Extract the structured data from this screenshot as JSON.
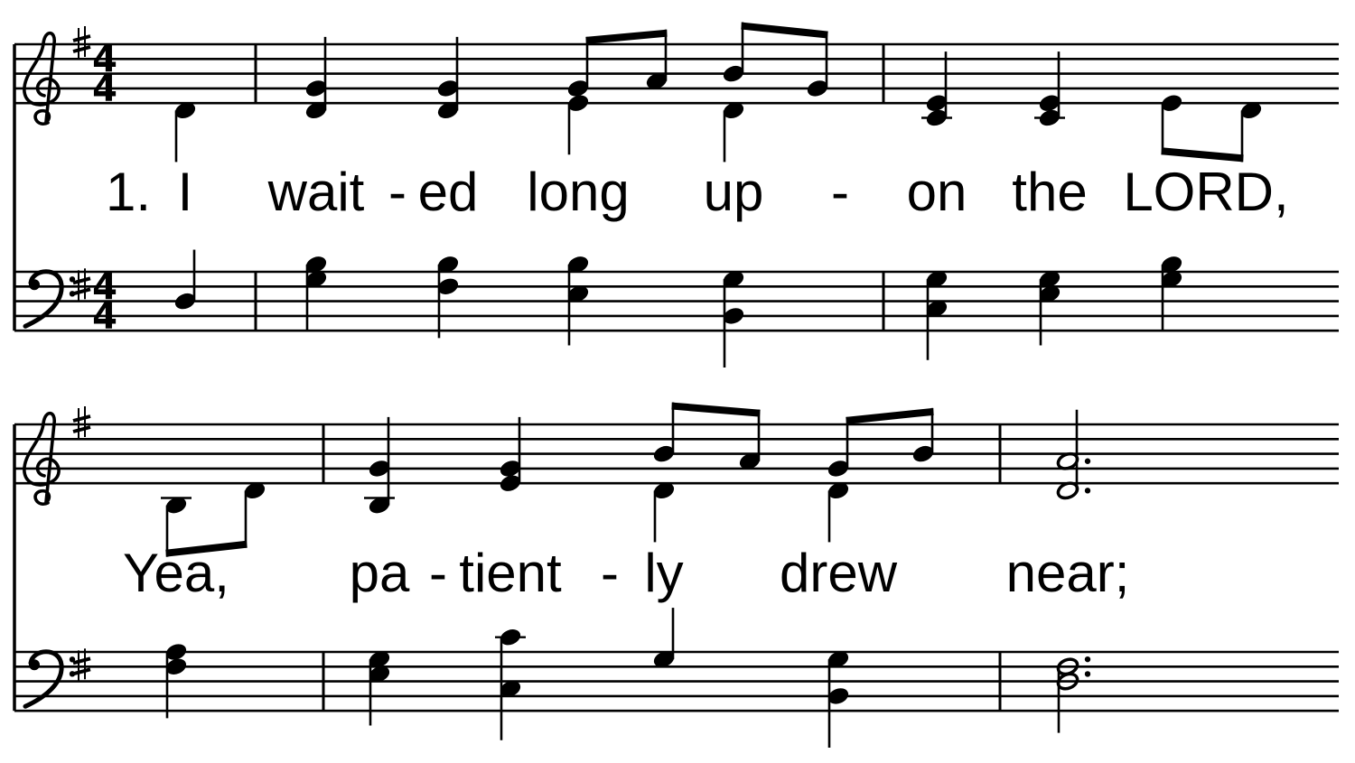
{
  "key_signature": "G major (1 sharp)",
  "time_signature": {
    "top": "4",
    "bottom": "4"
  },
  "ink_color": "#000000",
  "systems": [
    {
      "barlines": [
        "2-1",
        "3-1"
      ],
      "lyrics": [
        {
          "pos": "1-3.2",
          "text": "1."
        },
        {
          "pos": "1-4",
          "text": "I"
        },
        {
          "pos": "2-1",
          "text": "wait"
        },
        {
          "pos": "2-1.7",
          "text": "-"
        },
        {
          "pos": "2-2",
          "text": "ed"
        },
        {
          "pos": "2-3",
          "text": "long"
        },
        {
          "pos": "2-4",
          "text": "up"
        },
        {
          "pos": "2-4.6",
          "text": "-"
        },
        {
          "pos": "3-1",
          "text": "on"
        },
        {
          "pos": "3-2",
          "text": "the"
        },
        {
          "pos": "3-3.2",
          "text": "LORD,"
        }
      ],
      "treble": [
        {
          "pos": "1-4",
          "notes": [
            "D4"
          ],
          "dur": "q",
          "stem": "down"
        },
        {
          "pos": "2-1",
          "notes": [
            "G4",
            "D4"
          ],
          "dur": "q",
          "stem": "up"
        },
        {
          "pos": "2-2",
          "notes": [
            "G4",
            "D4"
          ],
          "dur": "q",
          "stem": "up"
        },
        {
          "pos": "2-3",
          "notes": [
            "G4"
          ],
          "dur": "e",
          "stem": "up",
          "beam": "a"
        },
        {
          "pos": "2-3.5",
          "notes": [
            "A4"
          ],
          "dur": "e",
          "stem": "up",
          "beam": "a"
        },
        {
          "pos": "2-3",
          "notes": [
            "E4"
          ],
          "dur": "q",
          "stem": "down"
        },
        {
          "pos": "2-4",
          "notes": [
            "B4"
          ],
          "dur": "e",
          "stem": "up",
          "beam": "b"
        },
        {
          "pos": "2-4.5",
          "notes": [
            "G4"
          ],
          "dur": "e",
          "stem": "up",
          "beam": "b"
        },
        {
          "pos": "2-4",
          "notes": [
            "D4"
          ],
          "dur": "q",
          "stem": "down"
        },
        {
          "pos": "3-1",
          "notes": [
            "E4",
            "C4"
          ],
          "dur": "q",
          "stem": "up"
        },
        {
          "pos": "3-2",
          "notes": [
            "E4",
            "C4"
          ],
          "dur": "q",
          "stem": "up"
        },
        {
          "pos": "3-3",
          "notes": [
            "E4"
          ],
          "dur": "e",
          "stem": "down",
          "beam": "c"
        },
        {
          "pos": "3-3.5",
          "notes": [
            "D4"
          ],
          "dur": "e",
          "stem": "down",
          "beam": "c"
        }
      ],
      "bass": [
        {
          "pos": "1-4",
          "notes": [
            "D3"
          ],
          "dur": "q",
          "stem": "up"
        },
        {
          "pos": "2-1",
          "notes": [
            "B3",
            "G3"
          ],
          "dur": "q",
          "stem": "down"
        },
        {
          "pos": "2-2",
          "notes": [
            "B3",
            "F3"
          ],
          "dur": "q",
          "stem": "down"
        },
        {
          "pos": "2-3",
          "notes": [
            "B3",
            "E3"
          ],
          "dur": "q",
          "stem": "down"
        },
        {
          "pos": "2-4",
          "notes": [
            "G3",
            "B2"
          ],
          "dur": "q",
          "stem": "down"
        },
        {
          "pos": "3-1",
          "notes": [
            "G3",
            "C3"
          ],
          "dur": "q",
          "stem": "down"
        },
        {
          "pos": "3-2",
          "notes": [
            "G3",
            "E3"
          ],
          "dur": "q",
          "stem": "down"
        },
        {
          "pos": "3-3",
          "notes": [
            "B3",
            "G3"
          ],
          "dur": "q",
          "stem": "down"
        }
      ]
    },
    {
      "barlines": [
        "4-1",
        "5-1"
      ],
      "lyrics": [
        {
          "pos": "3-4",
          "text": "Yea,"
        },
        {
          "pos": "4-1",
          "text": "pa"
        },
        {
          "pos": "4-1.5",
          "text": "-"
        },
        {
          "pos": "4-2",
          "text": "tient"
        },
        {
          "pos": "4-2.6",
          "text": "-"
        },
        {
          "pos": "4-3",
          "text": "ly"
        },
        {
          "pos": "4-4",
          "text": "drew"
        },
        {
          "pos": "5-1",
          "text": "near;"
        }
      ],
      "treble": [
        {
          "pos": "3-4",
          "notes": [
            "B3"
          ],
          "dur": "e",
          "stem": "down",
          "beam": "d"
        },
        {
          "pos": "3-4.5",
          "notes": [
            "D4"
          ],
          "dur": "e",
          "stem": "down",
          "beam": "d"
        },
        {
          "pos": "4-1",
          "notes": [
            "G4",
            "B3"
          ],
          "dur": "q",
          "stem": "up"
        },
        {
          "pos": "4-2",
          "notes": [
            "G4",
            "E4"
          ],
          "dur": "q",
          "stem": "up"
        },
        {
          "pos": "4-3",
          "notes": [
            "B4"
          ],
          "dur": "e",
          "stem": "up",
          "beam": "e"
        },
        {
          "pos": "4-3.5",
          "notes": [
            "A4"
          ],
          "dur": "e",
          "stem": "up",
          "beam": "e"
        },
        {
          "pos": "4-3",
          "notes": [
            "D4"
          ],
          "dur": "q",
          "stem": "down"
        },
        {
          "pos": "4-4",
          "notes": [
            "G4"
          ],
          "dur": "e",
          "stem": "up",
          "beam": "f"
        },
        {
          "pos": "4-4.5",
          "notes": [
            "B4"
          ],
          "dur": "e",
          "stem": "up",
          "beam": "f"
        },
        {
          "pos": "4-4",
          "notes": [
            "D4"
          ],
          "dur": "q",
          "stem": "down"
        },
        {
          "pos": "5-1",
          "notes": [
            "A4",
            "D4"
          ],
          "dur": "h.",
          "stem": "up"
        }
      ],
      "bass": [
        {
          "pos": "3-4",
          "notes": [
            "A3",
            "F3"
          ],
          "dur": "q",
          "stem": "down"
        },
        {
          "pos": "4-1",
          "notes": [
            "G3",
            "E3"
          ],
          "dur": "q",
          "stem": "down"
        },
        {
          "pos": "4-2",
          "notes": [
            "C4",
            "C3"
          ],
          "dur": "q",
          "stem": "down"
        },
        {
          "pos": "4-3",
          "notes": [
            "G3"
          ],
          "dur": "q",
          "stem": "up"
        },
        {
          "pos": "4-4",
          "notes": [
            "G3",
            "B2"
          ],
          "dur": "q",
          "stem": "down"
        },
        {
          "pos": "5-1",
          "notes": [
            "F3",
            "D3"
          ],
          "dur": "h.",
          "stem": "down"
        }
      ]
    }
  ]
}
